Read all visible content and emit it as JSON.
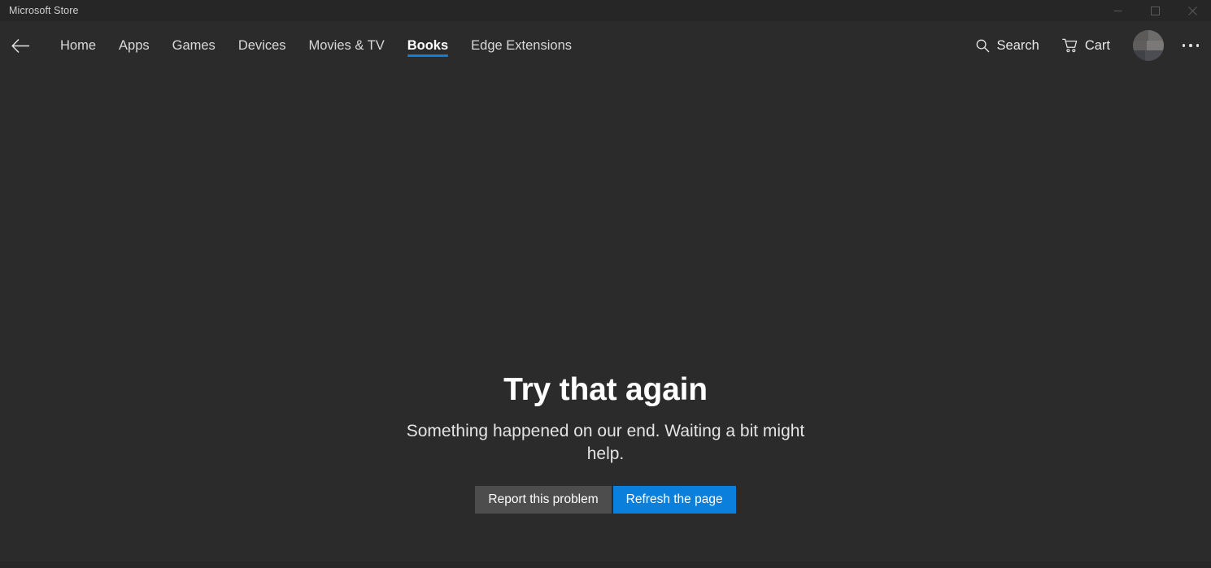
{
  "window": {
    "title": "Microsoft Store",
    "controls": {
      "minimize": "minimize",
      "maximize": "maximize",
      "close": "close"
    }
  },
  "nav": {
    "back_label": "Back",
    "items": [
      {
        "label": "Home",
        "active": false
      },
      {
        "label": "Apps",
        "active": false
      },
      {
        "label": "Games",
        "active": false
      },
      {
        "label": "Devices",
        "active": false
      },
      {
        "label": "Movies & TV",
        "active": false
      },
      {
        "label": "Books",
        "active": true
      },
      {
        "label": "Edge Extensions",
        "active": false
      }
    ],
    "actions": {
      "search_label": "Search",
      "cart_label": "Cart",
      "account_label": "Account",
      "more_label": "See more"
    }
  },
  "content": {
    "error_title": "Try that again",
    "error_message": "Something happened on our end. Waiting a bit might help.",
    "report_button": "Report this problem",
    "refresh_button": "Refresh the page"
  },
  "colors": {
    "accent": "#0a7fdb",
    "titlebar_bg": "#262626",
    "app_bg": "#2b2b2b",
    "secondary_button": "#4d4d4d",
    "text_primary": "#ffffff",
    "text_secondary": "#d9d9d9"
  }
}
